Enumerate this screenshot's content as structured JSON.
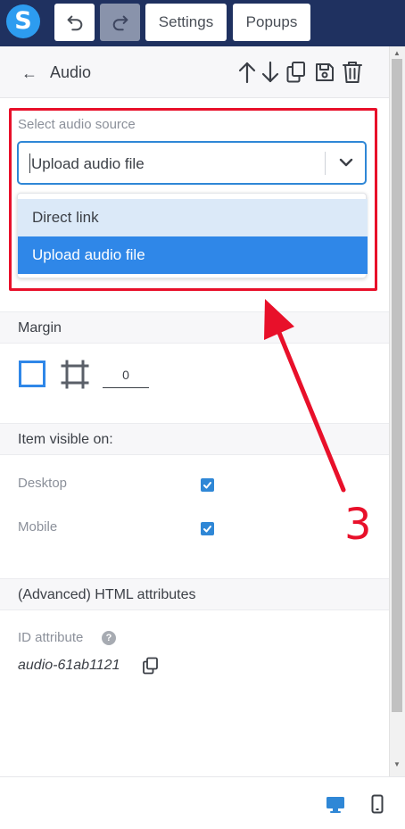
{
  "topbar": {
    "logo_letter": "S",
    "settings_label": "Settings",
    "popups_label": "Popups",
    "accent_color": "#1f3160"
  },
  "panel": {
    "title": "Audio",
    "icons": [
      "arrow-up-icon",
      "arrow-down-icon",
      "duplicate-icon",
      "save-icon",
      "trash-icon"
    ]
  },
  "audio_source": {
    "label": "Select audio source",
    "selected_value": "Upload audio file",
    "options": [
      {
        "label": "Direct link",
        "state": "hover"
      },
      {
        "label": "Upload audio file",
        "state": "selected"
      }
    ]
  },
  "margin": {
    "title": "Margin",
    "value": "0"
  },
  "visibility": {
    "title": "Item visible on:",
    "desktop_label": "Desktop",
    "desktop_checked": true,
    "mobile_label": "Mobile",
    "mobile_checked": true
  },
  "advanced": {
    "title": "(Advanced) HTML attributes",
    "id_label": "ID attribute",
    "help_glyph": "?",
    "id_value": "audio-61ab1121"
  },
  "annotation": {
    "step_number": "3",
    "color": "#e8102a"
  }
}
